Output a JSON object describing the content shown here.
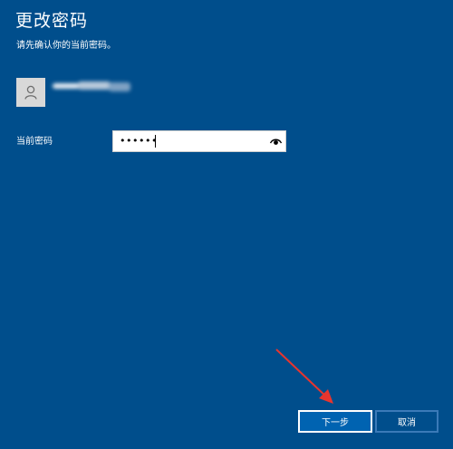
{
  "dialog": {
    "title": "更改密码",
    "subtitle": "请先确认你的当前密码。"
  },
  "user": {
    "avatar_icon": "user-icon"
  },
  "password": {
    "label": "当前密码",
    "value_masked": "••••••",
    "reveal_icon": "eye-icon"
  },
  "buttons": {
    "next_label": "下一步",
    "cancel_label": "取消"
  },
  "colors": {
    "background": "#004e8c",
    "primary_button": "#0063b1",
    "annotation_arrow": "#e8352e"
  }
}
